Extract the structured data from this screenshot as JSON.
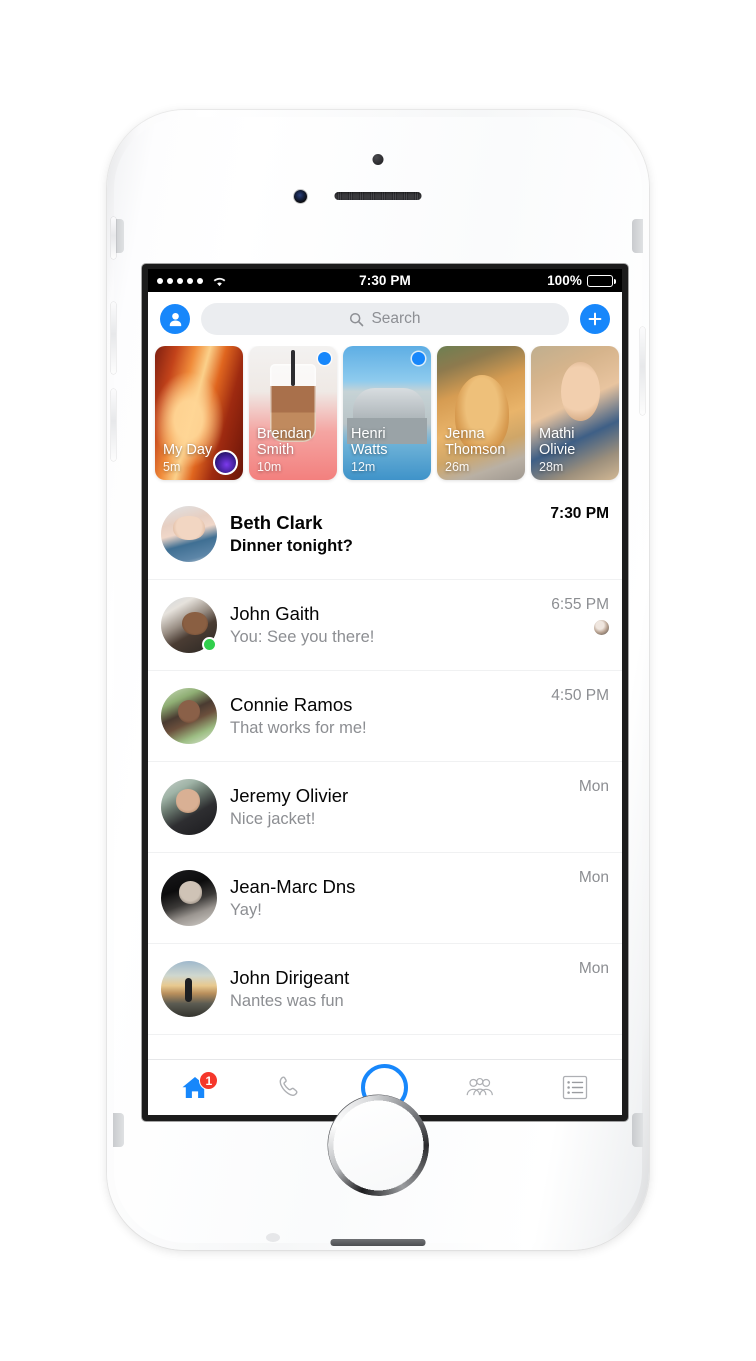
{
  "status_bar": {
    "signal_dots": 5,
    "wifi_icon": "wifi-icon",
    "time": "7:30 PM",
    "battery_percent": "100%",
    "battery_level": 100
  },
  "header": {
    "profile_icon": "profile-avatar-icon",
    "search": {
      "icon": "search-icon",
      "placeholder": "Search",
      "value": ""
    },
    "compose_icon": "plus-icon",
    "compose_label": "+"
  },
  "stories": [
    {
      "name": "My Day",
      "time": "5m",
      "art": "art-canyon",
      "has_dot": false,
      "has_badge": true
    },
    {
      "name": "Brendan\nSmith",
      "time": "10m",
      "art": "art-coffee",
      "has_dot": true,
      "has_badge": false
    },
    {
      "name": "Henri\nWatts",
      "time": "12m",
      "art": "art-building",
      "has_dot": true,
      "has_badge": false
    },
    {
      "name": "Jenna\nThomson",
      "time": "26m",
      "art": "art-dog",
      "has_dot": false,
      "has_badge": false
    },
    {
      "name": "Mathi\nOlivie",
      "time": "28m",
      "art": "art-girl",
      "has_dot": false,
      "has_badge": false
    }
  ],
  "conversations": [
    {
      "name": "Beth Clark",
      "preview": "Dinner tonight?",
      "time": "7:30 PM",
      "unread": true,
      "online": false,
      "read_receipt": false,
      "avatar": "av-beth"
    },
    {
      "name": "John Gaith",
      "preview": "You: See you there!",
      "time": "6:55 PM",
      "unread": false,
      "online": true,
      "read_receipt": true,
      "avatar": "av-john"
    },
    {
      "name": "Connie Ramos",
      "preview": "That works for me!",
      "time": "4:50 PM",
      "unread": false,
      "online": false,
      "read_receipt": false,
      "avatar": "av-connie"
    },
    {
      "name": "Jeremy Olivier",
      "preview": "Nice jacket!",
      "time": "Mon",
      "unread": false,
      "online": false,
      "read_receipt": false,
      "avatar": "av-jeremy"
    },
    {
      "name": "Jean-Marc Dns",
      "preview": "Yay!",
      "time": "Mon",
      "unread": false,
      "online": false,
      "read_receipt": false,
      "avatar": "av-jeanmarc"
    },
    {
      "name": "John Dirigeant",
      "preview": "Nantes was fun",
      "time": "Mon",
      "unread": false,
      "online": false,
      "read_receipt": false,
      "avatar": "av-dirigeant"
    }
  ],
  "tab_bar": [
    {
      "icon": "home-icon",
      "active": true,
      "badge": "1"
    },
    {
      "icon": "phone-icon",
      "active": false,
      "badge": ""
    },
    {
      "icon": "camera-icon",
      "active": false,
      "badge": ""
    },
    {
      "icon": "people-icon",
      "active": false,
      "badge": ""
    },
    {
      "icon": "list-icon",
      "active": false,
      "badge": ""
    }
  ],
  "colors": {
    "accent": "#1787fb",
    "badge_red": "#f5372b",
    "online_green": "#31cf4c",
    "text_primary": "#050505",
    "text_secondary": "#8c8e92",
    "search_bg": "#ebedf0"
  }
}
